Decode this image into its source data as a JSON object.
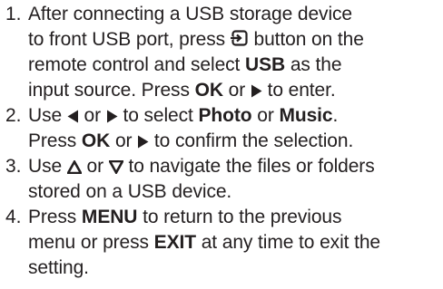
{
  "steps": [
    {
      "number": "1.",
      "lines": [
        [
          "After connecting a USB storage device"
        ],
        [
          "to front USB port, press ",
          {
            "icon": "input-source-icon"
          },
          " button on the"
        ],
        [
          "remote control and select ",
          {
            "b": "USB"
          },
          " as the"
        ],
        [
          "input source. Press ",
          {
            "b": "OK"
          },
          " or ",
          {
            "icon": "right-arrow-icon"
          },
          " to enter."
        ]
      ]
    },
    {
      "number": "2.",
      "lines": [
        [
          "Use ",
          {
            "icon": "left-arrow-icon"
          },
          " or ",
          {
            "icon": "right-arrow-icon"
          },
          " to select ",
          {
            "b": "Photo"
          },
          " or ",
          {
            "b": "Music"
          },
          "."
        ],
        [
          "Press ",
          {
            "b": "OK"
          },
          " or ",
          {
            "icon": "right-arrow-icon"
          },
          " to confirm the selection."
        ]
      ]
    },
    {
      "number": "3.",
      "lines": [
        [
          "Use ",
          {
            "icon": "up-arrow-icon"
          },
          " or ",
          {
            "icon": "down-arrow-icon"
          },
          " to navigate the files or folders"
        ],
        [
          "stored on a USB device."
        ]
      ]
    },
    {
      "number": "4.",
      "lines": [
        [
          "Press ",
          {
            "b": "MENU"
          },
          " to return to the previous"
        ],
        [
          "menu or press ",
          {
            "b": "EXIT"
          },
          " at any time to exit the"
        ],
        [
          "setting."
        ]
      ]
    }
  ],
  "colors": {
    "text": "#231f20",
    "background": "#ffffff"
  }
}
